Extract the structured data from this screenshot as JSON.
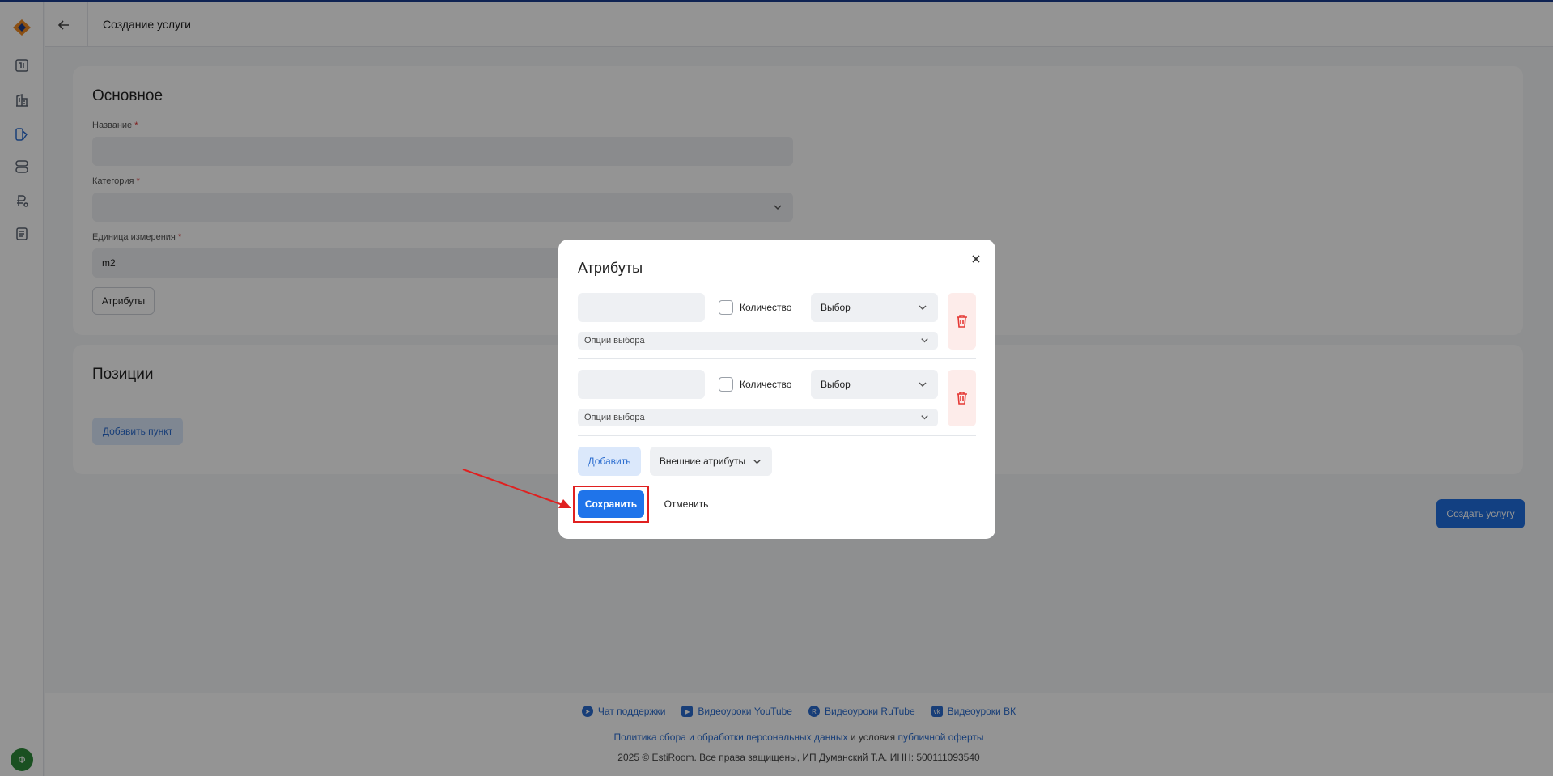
{
  "header": {
    "title": "Создание услуги"
  },
  "user": {
    "avatar_letter": "Ф"
  },
  "main": {
    "section_title": "Основное",
    "fields": {
      "name_label": "Название",
      "category_label": "Категория",
      "unit_label": "Единица измерения",
      "unit_value": "m2",
      "required_mark": "*"
    },
    "attributes_button": "Атрибуты"
  },
  "positions": {
    "title": "Позиции",
    "add_item_button": "Добавить пункт"
  },
  "create_button": "Создать услугу",
  "footer": {
    "links": [
      "Чат поддержки",
      "Видеоуроки YouTube",
      "Видеоуроки RuTube",
      "Видеоуроки ВК"
    ],
    "policy_link": "Политика сбора и обработки персональных данных",
    "policy_middle": "и условия",
    "offer_link": "публичной оферты",
    "copyright": "2025 © EstiRoom. Все права защищены, ИП Думанский Т.А. ИНН: 500111093540"
  },
  "modal": {
    "title": "Атрибуты",
    "rows": [
      {
        "quantity_label": "Количество",
        "select_value": "Выбор",
        "options_placeholder": "Опции выбора"
      },
      {
        "quantity_label": "Количество",
        "select_value": "Выбор",
        "options_placeholder": "Опции выбора"
      }
    ],
    "add_button": "Добавить",
    "external_button": "Внешние атрибуты",
    "save_button": "Сохранить",
    "cancel_button": "Отменить"
  },
  "colors": {
    "primary": "#1f74ea",
    "accent_red": "#e02020",
    "danger": "#e53935"
  }
}
